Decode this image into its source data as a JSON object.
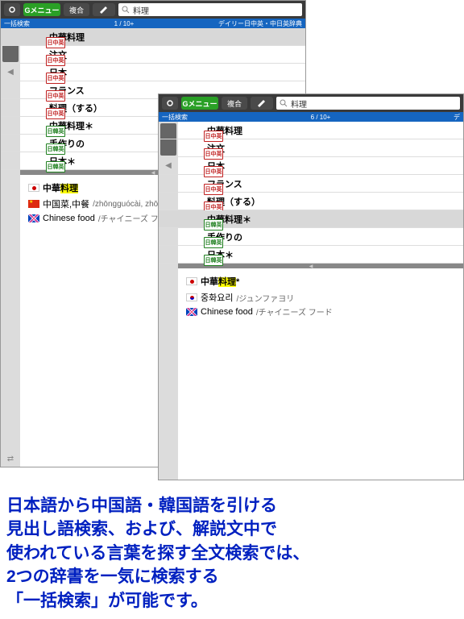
{
  "toolbar": {
    "menu": "Gメニュー",
    "mid_label": "複合",
    "search_value": "料理"
  },
  "screen1": {
    "status_left": "一括検索",
    "status_center": "1 / 10+",
    "status_right": "デイリー日中英・中日英辞典",
    "items": [
      {
        "badge": "日中英",
        "label": "中華料理",
        "sel": true
      },
      {
        "badge": "日中英",
        "label": "注文"
      },
      {
        "badge": "日中英",
        "label": "日本"
      },
      {
        "badge": "日中英",
        "label": "フランス"
      },
      {
        "badge": "日中英",
        "label": "料理（する）"
      },
      {
        "badge": "日韓英",
        "label": "中華料理＊"
      },
      {
        "badge": "日韓英",
        "label": "手作りの"
      },
      {
        "badge": "日韓英",
        "label": "日本＊"
      }
    ],
    "detail": {
      "head_prefix": "中華",
      "head_hl": "料理",
      "cn": "中国菜,中餐",
      "cn_rom": "/zhōngguócài, zhōngcān /",
      "en": "Chinese food",
      "en_rom": "/チャイニーズ フード"
    }
  },
  "screen2": {
    "status_left": "一括検索",
    "status_center": "6 / 10+",
    "status_right": "デ",
    "items": [
      {
        "badge": "日中英",
        "label": "中華料理"
      },
      {
        "badge": "日中英",
        "label": "注文"
      },
      {
        "badge": "日中英",
        "label": "日本"
      },
      {
        "badge": "日中英",
        "label": "フランス"
      },
      {
        "badge": "日中英",
        "label": "料理（する）"
      },
      {
        "badge": "日韓英",
        "label": "中華料理＊",
        "sel": true
      },
      {
        "badge": "日韓英",
        "label": "手作りの"
      },
      {
        "badge": "日韓英",
        "label": "日本＊"
      }
    ],
    "detail": {
      "head_prefix": "中華",
      "head_hl": "料理",
      "head_suffix": "*",
      "kr": "중화요리",
      "kr_rom": "/ジュンファヨリ",
      "en": "Chinese food",
      "en_rom": "/チャイニーズ フード"
    }
  },
  "caption": "日本語から中国語・韓国語を引ける\n見出し語検索、および、解説文中で\n使われている言葉を探す全文検索では、\n2つの辞書を一気に検索する\n「一括検索」が可能です。"
}
